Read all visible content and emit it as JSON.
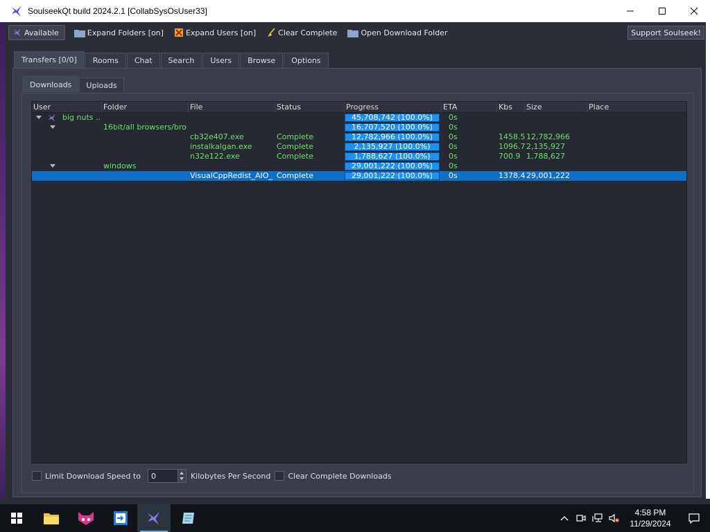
{
  "window": {
    "title": "SoulseekQt build 2024.2.1 [CollabSysOsUser33]"
  },
  "toolbar": {
    "available": "Available",
    "expand_folders": "Expand Folders [on]",
    "expand_users": "Expand Users [on]",
    "clear_complete": "Clear Complete",
    "open_download_folder": "Open Download Folder",
    "support": "Support Soulseek!"
  },
  "tabs": [
    "Transfers [0/0]",
    "Rooms",
    "Chat",
    "Search",
    "Users",
    "Browse",
    "Options"
  ],
  "subtabs": [
    "Downloads",
    "Uploads"
  ],
  "columns": [
    "User",
    "Folder",
    "File",
    "Status",
    "Progress",
    "ETA",
    "Kbs",
    "Size",
    "Place"
  ],
  "rows": [
    {
      "user": "big nuts ...",
      "folder": "",
      "file": "",
      "status": "",
      "progress": "45,708,742 (100.0%)",
      "eta": "0s",
      "kbs": "",
      "size": ""
    },
    {
      "user": "",
      "folder": "16bit/all browsers/bro...",
      "file": "",
      "status": "",
      "progress": "16,707,520 (100.0%)",
      "eta": "0s",
      "kbs": "",
      "size": ""
    },
    {
      "user": "",
      "folder": "",
      "file": "cb32e407.exe",
      "status": "Complete",
      "progress": "12,782,966 (100.0%)",
      "eta": "0s",
      "kbs": "1458.5",
      "size": "12,782,966"
    },
    {
      "user": "",
      "folder": "",
      "file": "instalkalgan.exe",
      "status": "Complete",
      "progress": "2,135,927 (100.0%)",
      "eta": "0s",
      "kbs": "1096.7",
      "size": "2,135,927"
    },
    {
      "user": "",
      "folder": "",
      "file": "n32e122.exe",
      "status": "Complete",
      "progress": "1,788,627 (100.0%)",
      "eta": "0s",
      "kbs": "700.9",
      "size": "1,788,627"
    },
    {
      "user": "",
      "folder": "windows",
      "file": "",
      "status": "",
      "progress": "29,001,222 (100.0%)",
      "eta": "0s",
      "kbs": "",
      "size": ""
    },
    {
      "user": "",
      "folder": "",
      "file": "VisualCppRedist_AIO_...",
      "status": "Complete",
      "progress": "29,001,222 (100.0%)",
      "eta": "0s",
      "kbs": "1378.4",
      "size": "29,001,222"
    }
  ],
  "bottom": {
    "limit_label": "Limit Download Speed to",
    "speed_value": "0",
    "unit_label": "Kilobytes Per Second",
    "clear_label": "Clear Complete Downloads"
  },
  "taskbar": {
    "time": "4:58 PM",
    "date": "11/29/2024",
    "apps": [
      "file-explorer-icon",
      "browser-icon",
      "remote-app-icon",
      "soulseek-icon",
      "notepad-icon"
    ]
  },
  "colors": {
    "accent": "#1c8ce8",
    "text_green": "#6ee06e",
    "selected_row": "#0f6fc6"
  }
}
